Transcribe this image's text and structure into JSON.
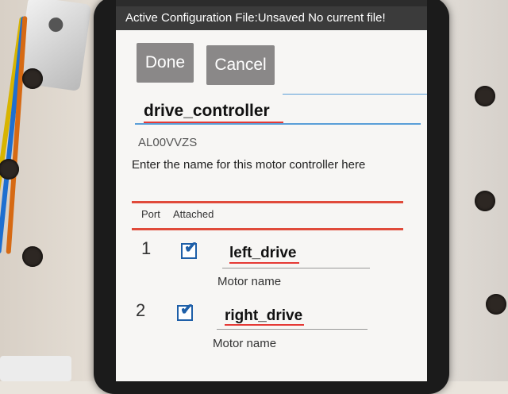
{
  "header": {
    "title": "Active Configuration File:Unsaved No current file!"
  },
  "toolbar": {
    "done_label": "Done",
    "cancel_label": "Cancel"
  },
  "controller": {
    "name_value": "drive_controller",
    "serial": "AL00VVZS",
    "hint": "Enter the name for this motor controller here"
  },
  "table": {
    "columns": [
      "Port",
      "Attached"
    ],
    "rows": [
      {
        "port": "1",
        "attached": true,
        "motor_name": "left_drive",
        "label": "Motor name"
      },
      {
        "port": "2",
        "attached": true,
        "motor_name": "right_drive",
        "label": "Motor name"
      }
    ]
  },
  "icons": {
    "checkbox_checked": "checkbox-checked-icon"
  },
  "colors": {
    "title_bar": "#3b3b3b",
    "button": "#8a8888",
    "accent_red": "#e04a3a",
    "checkbox_blue": "#1e5fa8"
  }
}
